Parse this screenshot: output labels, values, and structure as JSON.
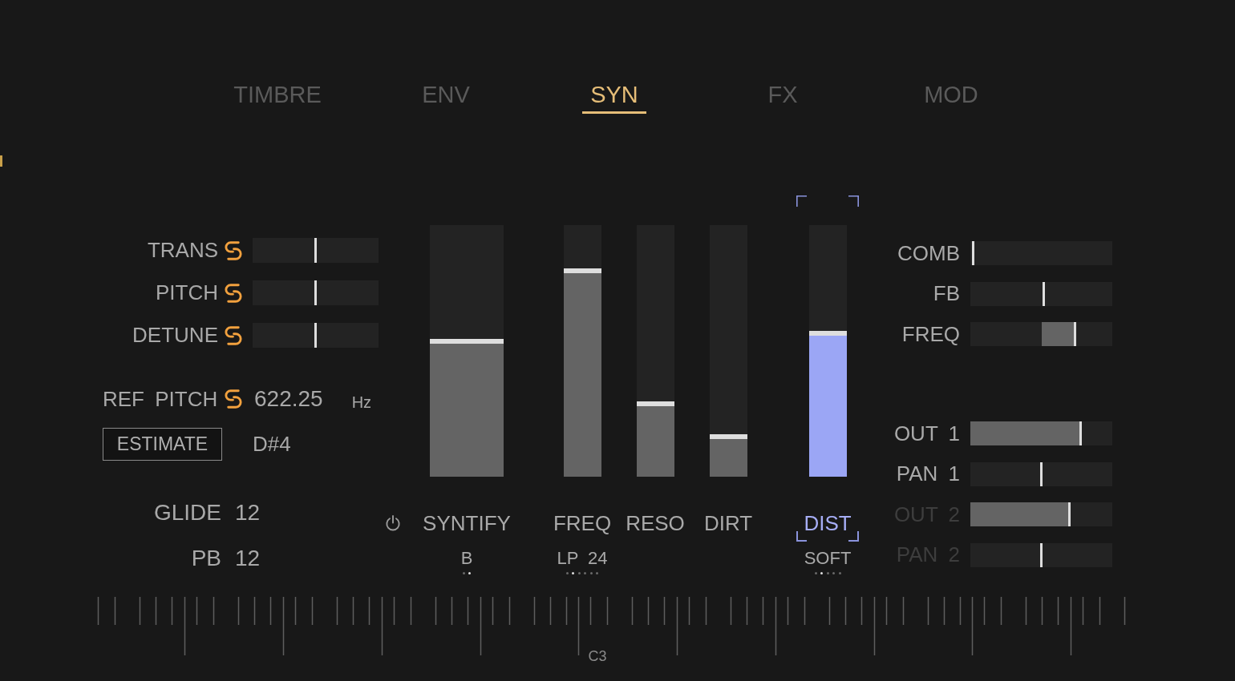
{
  "tabs": [
    {
      "label": "TIMBRE",
      "selected": false
    },
    {
      "label": "ENV",
      "selected": false
    },
    {
      "label": "SYN",
      "selected": true
    },
    {
      "label": "FX",
      "selected": false
    },
    {
      "label": "MOD",
      "selected": false
    }
  ],
  "pitch_panel": {
    "sliders": [
      {
        "label": "TRANS",
        "linked": true,
        "level": 0.5
      },
      {
        "label": "PITCH",
        "linked": true,
        "level": 0.5
      },
      {
        "label": "DETUNE",
        "linked": true,
        "level": 0.5
      }
    ],
    "ref_pitch": {
      "label": "REF PITCH",
      "linked": true,
      "value": "622.25",
      "unit": "Hz"
    },
    "estimate_button": "ESTIMATE",
    "note": "D#4",
    "settings": [
      {
        "label": "GLIDE",
        "value": "12"
      },
      {
        "label": "PB",
        "value": "12"
      }
    ]
  },
  "syn_panel": {
    "groups": [
      {
        "power_switch": true,
        "faders": [
          {
            "label": "SYNTIFY",
            "kind": "wide",
            "level": 0.53,
            "selected": false,
            "mode": "B",
            "mode_dots": [
              {
                "selected": false
              },
              {
                "selected": true
              }
            ]
          }
        ]
      },
      {
        "faders": [
          {
            "label": "FREQ",
            "kind": "narrow",
            "level": 0.81,
            "selected": false,
            "mode": "LP 24",
            "mode_dots": [
              {
                "selected": false
              },
              {
                "selected": true
              },
              {
                "selected": false
              },
              {
                "selected": false
              },
              {
                "selected": false
              },
              {
                "selected": false
              }
            ]
          },
          {
            "label": "RESO",
            "kind": "narrow",
            "level": 0.28,
            "selected": false
          },
          {
            "label": "DIRT",
            "kind": "narrow",
            "level": 0.15,
            "selected": false
          }
        ]
      },
      {
        "faders": [
          {
            "label": "DIST",
            "kind": "narrow",
            "level": 0.56,
            "selected": true,
            "mode": "SOFT",
            "mode_dots": [
              {
                "selected": false
              },
              {
                "selected": true
              },
              {
                "selected": false
              },
              {
                "selected": false
              },
              {
                "selected": false
              }
            ]
          }
        ]
      }
    ]
  },
  "right_panel": {
    "comb": [
      {
        "label": "COMB",
        "kind": "unipolar",
        "level": 0.01
      },
      {
        "label": "FB",
        "kind": "bipolar",
        "level": 0.52
      },
      {
        "label": "FREQ",
        "kind": "bipolar",
        "level": 0.74
      }
    ],
    "outputs": [
      {
        "label": "OUT 1",
        "kind": "unipolar",
        "level": 0.78,
        "disabled": false
      },
      {
        "label": "PAN 1",
        "kind": "bipolar",
        "level": 0.5,
        "disabled": false
      },
      {
        "label": "OUT 2",
        "kind": "unipolar",
        "level": 0.7,
        "disabled": true
      },
      {
        "label": "PAN 2",
        "kind": "bipolar",
        "level": 0.5,
        "disabled": true
      }
    ]
  },
  "ruler": {
    "octave_label": "C3"
  }
}
